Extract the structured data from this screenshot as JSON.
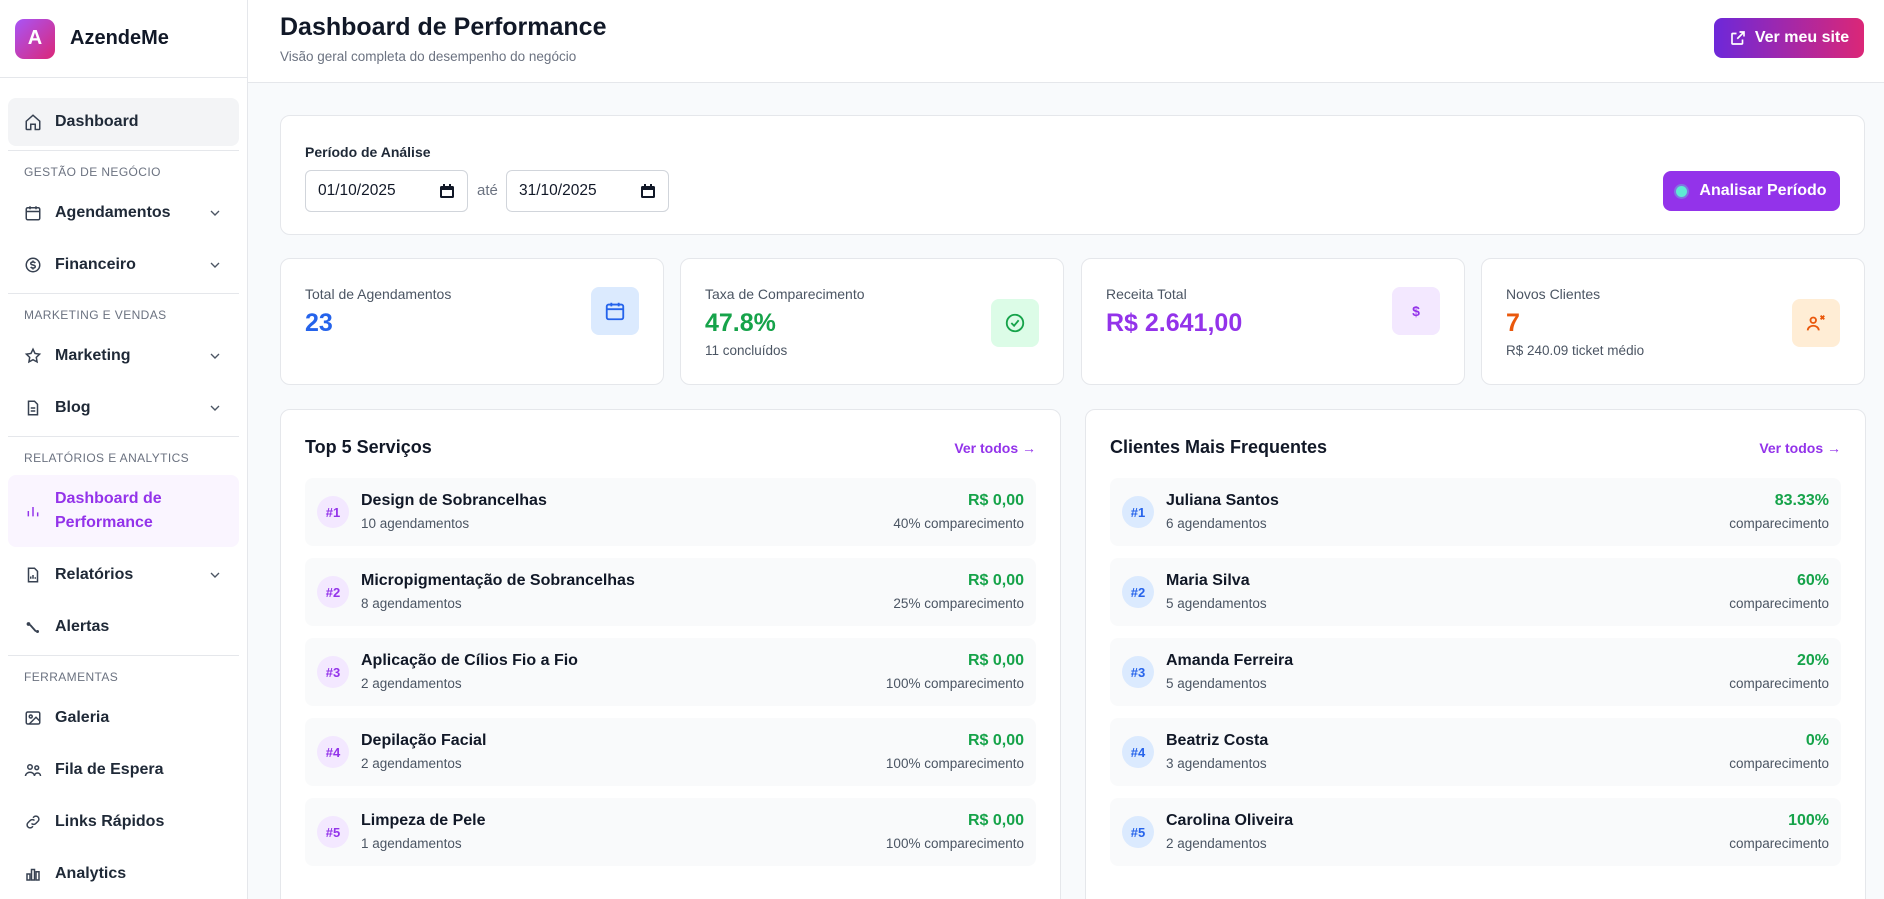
{
  "brand": {
    "logo_letter": "A",
    "name": "AzendeMe"
  },
  "nav": {
    "dashboard": "Dashboard",
    "section_gestao": "GESTÃO DE NEGÓCIO",
    "agendamentos": "Agendamentos",
    "financeiro": "Financeiro",
    "section_marketing": "MARKETING E VENDAS",
    "marketing": "Marketing",
    "blog": "Blog",
    "section_relatorios": "RELATÓRIOS E ANALYTICS",
    "dashboard_performance_1": "Dashboard de",
    "dashboard_performance_2": "Performance",
    "relatorios": "Relatórios",
    "alertas": "Alertas",
    "section_ferramentas": "FERRAMENTAS",
    "galeria": "Galeria",
    "fila_espera": "Fila de Espera",
    "links_rapidos": "Links Rápidos",
    "analytics": "Analytics"
  },
  "header": {
    "title": "Dashboard de Performance",
    "subtitle": "Visão geral completa do desempenho do negócio",
    "site_button": "Ver meu site"
  },
  "period": {
    "label": "Período de Análise",
    "start": "01/10/2025",
    "separator": "até",
    "end": "31/10/2025",
    "analyze_button": "Analisar Período"
  },
  "stats": {
    "total": {
      "label": "Total de Agendamentos",
      "value": "23",
      "color": "#2563eb"
    },
    "taxa": {
      "label": "Taxa de Comparecimento",
      "value": "47.8%",
      "sub": "11 concluídos",
      "color": "#16a34a"
    },
    "receita": {
      "label": "Receita Total",
      "value": "R$ 2.641,00",
      "color": "#9333ea",
      "icon_glyph": "$"
    },
    "novos": {
      "label": "Novos Clientes",
      "value": "7",
      "sub": "R$ 240.09 ticket médio",
      "color": "#ea580c"
    }
  },
  "services": {
    "title": "Top 5 Serviços",
    "link": "Ver todos →",
    "items": [
      {
        "rank": "#1",
        "name": "Design de Sobrancelhas",
        "meta": "10 agendamentos",
        "value": "R$ 0,00",
        "sub": "40% comparecimento"
      },
      {
        "rank": "#2",
        "name": "Micropigmentação de Sobrancelhas",
        "meta": "8 agendamentos",
        "value": "R$ 0,00",
        "sub": "25% comparecimento"
      },
      {
        "rank": "#3",
        "name": "Aplicação de Cílios Fio a Fio",
        "meta": "2 agendamentos",
        "value": "R$ 0,00",
        "sub": "100% comparecimento"
      },
      {
        "rank": "#4",
        "name": "Depilação Facial",
        "meta": "2 agendamentos",
        "value": "R$ 0,00",
        "sub": "100% comparecimento"
      },
      {
        "rank": "#5",
        "name": "Limpeza de Pele",
        "meta": "1 agendamentos",
        "value": "R$ 0,00",
        "sub": "100% comparecimento"
      }
    ]
  },
  "clients": {
    "title": "Clientes Mais Frequentes",
    "link": "Ver todos →",
    "items": [
      {
        "rank": "#1",
        "name": "Juliana Santos",
        "meta": "6 agendamentos",
        "value": "83.33%",
        "sub": "comparecimento"
      },
      {
        "rank": "#2",
        "name": "Maria Silva",
        "meta": "5 agendamentos",
        "value": "60%",
        "sub": "comparecimento"
      },
      {
        "rank": "#3",
        "name": "Amanda Ferreira",
        "meta": "5 agendamentos",
        "value": "20%",
        "sub": "comparecimento"
      },
      {
        "rank": "#4",
        "name": "Beatriz Costa",
        "meta": "3 agendamentos",
        "value": "0%",
        "sub": "comparecimento"
      },
      {
        "rank": "#5",
        "name": "Carolina Oliveira",
        "meta": "2 agendamentos",
        "value": "100%",
        "sub": "comparecimento"
      }
    ]
  },
  "colors": {
    "accent": "#9333ea",
    "success": "#16a34a",
    "blue": "#2563eb",
    "orange": "#ea580c"
  }
}
